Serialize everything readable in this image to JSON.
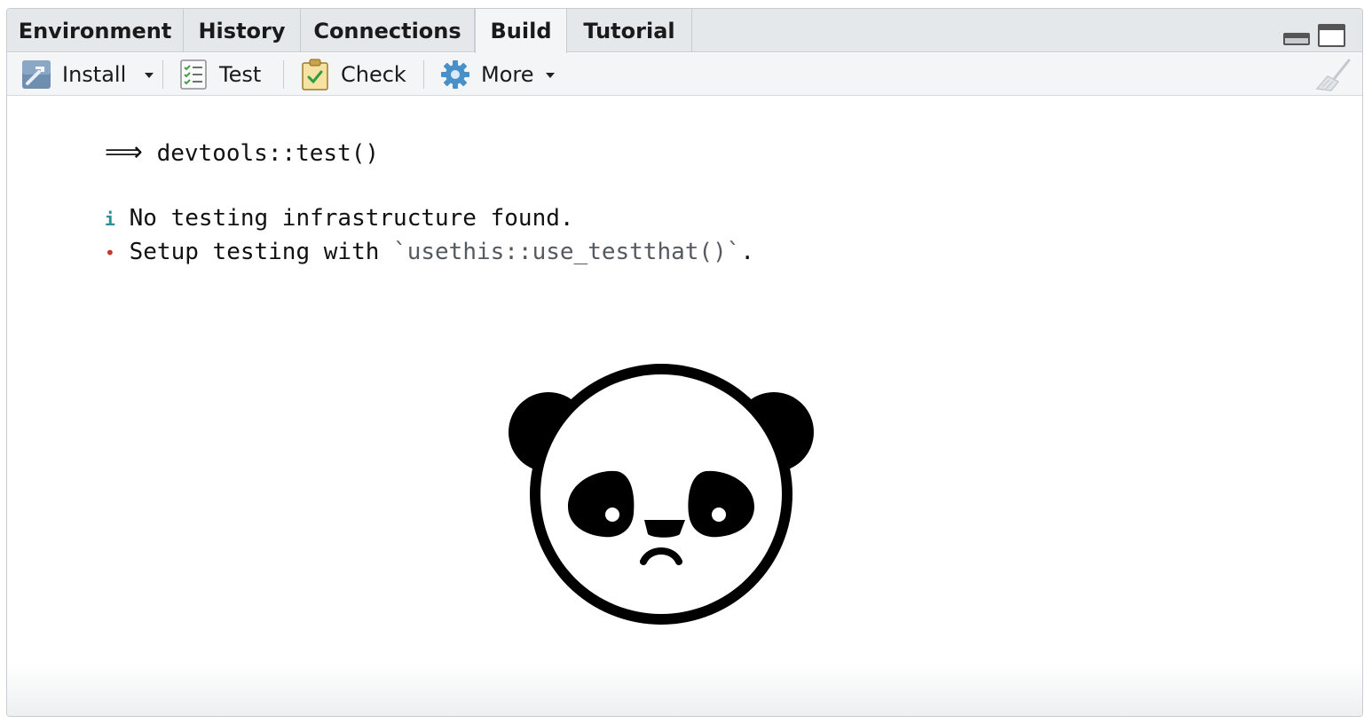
{
  "tabs": [
    {
      "label": "Environment",
      "active": false
    },
    {
      "label": "History",
      "active": false
    },
    {
      "label": "Connections",
      "active": false
    },
    {
      "label": "Build",
      "active": true
    },
    {
      "label": "Tutorial",
      "active": false
    }
  ],
  "toolbar": {
    "install_label": "Install",
    "test_label": "Test",
    "check_label": "Check",
    "more_label": "More",
    "icons": [
      "hammer-icon",
      "checklist-icon",
      "clipboard-check-icon",
      "gear-icon",
      "broom-icon"
    ]
  },
  "console": {
    "arrow": "⟹",
    "command": "devtools::test()",
    "info_marker": "i",
    "info_text": "No testing infrastructure found.",
    "bullet_marker": "•",
    "setup_prefix": "Setup testing with ",
    "setup_code": "`usethis::use_testthat()`",
    "setup_suffix": "."
  },
  "colors": {
    "info": "#2a8f9a",
    "bullet": "#c0392b",
    "tabbar_bg": "#e5e8eb",
    "toolbar_bg": "#f3f5f7"
  }
}
